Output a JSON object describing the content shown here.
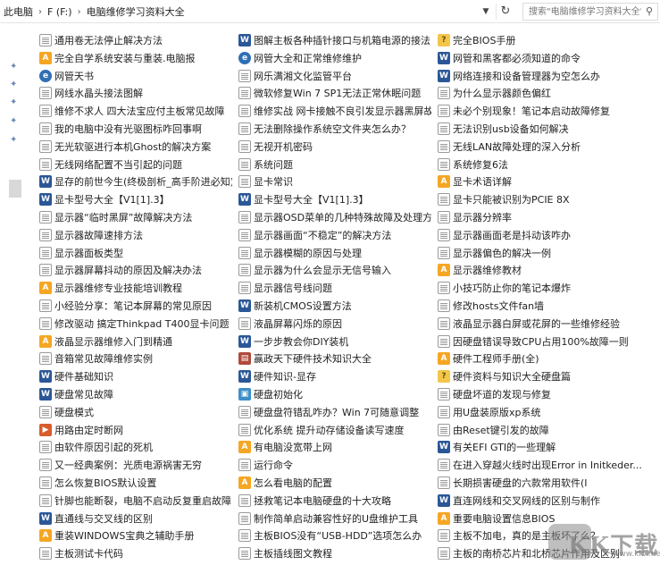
{
  "address": {
    "crumbs": [
      "此电脑",
      "F (F:)",
      "电脑维修学习资料大全"
    ],
    "search_placeholder": "搜索\"电脑维修学习资料大全\""
  },
  "files": [
    [
      {
        "icon": "doc",
        "label": "通用卷无法停止解决方法"
      },
      {
        "icon": "pdf",
        "label": "完全自学系统安装与重装.电脑报"
      },
      {
        "icon": "web",
        "label": "网管天书"
      },
      {
        "icon": "doc",
        "label": "网线水晶头接法图解"
      },
      {
        "icon": "doc",
        "label": "维修不求人 四大法宝应付主板常见故障"
      },
      {
        "icon": "doc",
        "label": "我的电脑中没有光驱图标咋回事啊"
      },
      {
        "icon": "doc",
        "label": "无光软驱进行本机Ghost的解决方案"
      },
      {
        "icon": "doc",
        "label": "无线网络配置不当引起的问题"
      },
      {
        "icon": "word",
        "label": "显存的前世今生(终极剖析_高手阶进必知)"
      },
      {
        "icon": "word",
        "label": "显卡型号大全【V1[1].3】"
      },
      {
        "icon": "doc",
        "label": "显示器“临时黑屏”故障解决方法"
      },
      {
        "icon": "doc",
        "label": "显示器故障速排方法"
      },
      {
        "icon": "doc",
        "label": "显示器面板类型"
      },
      {
        "icon": "doc",
        "label": "显示器屏幕抖动的原因及解决办法"
      },
      {
        "icon": "pdf",
        "label": "显示器维修专业技能培训教程"
      },
      {
        "icon": "doc",
        "label": "小经验分享：笔记本屏幕的常见原因"
      },
      {
        "icon": "doc",
        "label": "修改驱动 搞定Thinkpad T400显卡问题"
      },
      {
        "icon": "pdf",
        "label": "液晶显示器维修入门到精通"
      },
      {
        "icon": "doc",
        "label": "音箱常见故障维修实例"
      },
      {
        "icon": "word",
        "label": "硬件基础知识"
      },
      {
        "icon": "word",
        "label": "硬盘常见故障"
      },
      {
        "icon": "doc",
        "label": "硬盘模式"
      },
      {
        "icon": "exe",
        "label": "用路由定时断网"
      },
      {
        "icon": "doc",
        "label": "由软件原因引起的死机"
      },
      {
        "icon": "doc",
        "label": "又一经典案例：光质电源祸害无穷"
      },
      {
        "icon": "doc",
        "label": "怎么恢复BIOS默认设置"
      },
      {
        "icon": "doc",
        "label": "针脚也能断裂，电脑不启动反复重启故障"
      },
      {
        "icon": "word",
        "label": "直通线与交叉线的区别"
      },
      {
        "icon": "pdf",
        "label": "重装WINDOWS宝典之辅助手册"
      },
      {
        "icon": "doc",
        "label": "主板测试卡代码"
      }
    ],
    [
      {
        "icon": "word",
        "label": "图解主板各种插针接口与机箱电源的接法"
      },
      {
        "icon": "web",
        "label": "网管大全和正常维修维护"
      },
      {
        "icon": "doc",
        "label": "网乐满湘文化监管平台"
      },
      {
        "icon": "doc",
        "label": "微软修复Win 7 SP1无法正常休眠问题"
      },
      {
        "icon": "doc",
        "label": "维修实战 网卡接触不良引发显示器黑屏故..."
      },
      {
        "icon": "doc",
        "label": "无法删除操作系统空文件夹怎么办？"
      },
      {
        "icon": "doc",
        "label": "无视开机密码"
      },
      {
        "icon": "doc",
        "label": "系统问题"
      },
      {
        "icon": "doc",
        "label": "显卡常识"
      },
      {
        "icon": "word",
        "label": "显卡型号大全【V1[1].3】"
      },
      {
        "icon": "doc",
        "label": "显示器OSD菜单的几种特殊故障及处理方法"
      },
      {
        "icon": "doc",
        "label": "显示器画面“不稳定”的解决方法"
      },
      {
        "icon": "doc",
        "label": "显示器模糊的原因与处理"
      },
      {
        "icon": "doc",
        "label": "显示器为什么会显示无信号输入"
      },
      {
        "icon": "doc",
        "label": "显示器信号线问题"
      },
      {
        "icon": "word",
        "label": "新装机CMOS设置方法"
      },
      {
        "icon": "doc",
        "label": "液晶屏幕闪烁的原因"
      },
      {
        "icon": "word",
        "label": "一步步教会你DIY装机"
      },
      {
        "icon": "book",
        "label": "赢政天下硬件技术知识大全"
      },
      {
        "icon": "word",
        "label": "硬件知识-显存"
      },
      {
        "icon": "img",
        "label": "硬盘初始化"
      },
      {
        "icon": "doc",
        "label": "硬盘盘符错乱咋办？Win 7可随意调整"
      },
      {
        "icon": "doc",
        "label": "优化系统 提升动存储设备读写速度"
      },
      {
        "icon": "pdf",
        "label": "有电脑没宽带上网"
      },
      {
        "icon": "doc",
        "label": "运行命令"
      },
      {
        "icon": "pdf",
        "label": "怎么看电脑的配置"
      },
      {
        "icon": "doc",
        "label": "拯救笔记本电脑硬盘的十大攻略"
      },
      {
        "icon": "doc",
        "label": "制作简单启动兼容性好的U盘维护工具"
      },
      {
        "icon": "doc",
        "label": "主板BIOS没有“USB-HDD”选项怎么办"
      },
      {
        "icon": "doc",
        "label": "主板插线图文教程"
      }
    ],
    [
      {
        "icon": "chm",
        "label": "完全BIOS手册"
      },
      {
        "icon": "word",
        "label": "网管和黑客都必须知道的命令"
      },
      {
        "icon": "word",
        "label": "网络连接和设备管理器为空怎么办"
      },
      {
        "icon": "doc",
        "label": "为什么显示器颜色偏红"
      },
      {
        "icon": "doc",
        "label": "未必个别现象！笔记本启动故障修复"
      },
      {
        "icon": "doc",
        "label": "无法识别usb设备如何解决"
      },
      {
        "icon": "doc",
        "label": "无线LAN故障处理的深入分析"
      },
      {
        "icon": "doc",
        "label": "系统修复6法"
      },
      {
        "icon": "pdf",
        "label": "显卡术语详解"
      },
      {
        "icon": "doc",
        "label": "显卡只能被识别为PCIE 8X"
      },
      {
        "icon": "doc",
        "label": "显示器分辨率"
      },
      {
        "icon": "doc",
        "label": "显示器画面老是抖动该咋办"
      },
      {
        "icon": "doc",
        "label": "显示器偏色的解决一例"
      },
      {
        "icon": "pdf",
        "label": "显示器维修教材"
      },
      {
        "icon": "doc",
        "label": "小技巧防止你的笔记本爆炸"
      },
      {
        "icon": "doc",
        "label": "修改hosts文件fan墙"
      },
      {
        "icon": "doc",
        "label": "液晶显示器白屏或花屏的一些维修经验"
      },
      {
        "icon": "doc",
        "label": "因硬盘错误导致CPU占用100%故障一则"
      },
      {
        "icon": "pdf",
        "label": "硬件工程师手册(全)"
      },
      {
        "icon": "chm",
        "label": "硬件资料与知识大全硬盘篇"
      },
      {
        "icon": "doc",
        "label": "硬盘坏道的发现与修复"
      },
      {
        "icon": "doc",
        "label": "用U盘装原版xp系统"
      },
      {
        "icon": "doc",
        "label": "由Reset键引发的故障"
      },
      {
        "icon": "word",
        "label": "有关EFI GTI的一些理解"
      },
      {
        "icon": "doc",
        "label": "在进入穿越火线时出现Error in Initkeder..."
      },
      {
        "icon": "doc",
        "label": "长期损害硬盘的六款常用软件(I"
      },
      {
        "icon": "word",
        "label": "直连网线和交叉网线的区别与制作"
      },
      {
        "icon": "pdf",
        "label": "重要电脑设置信息BIOS"
      },
      {
        "icon": "doc",
        "label": "主板不加电，真的是主板坏了么？"
      },
      {
        "icon": "doc",
        "label": "主板的南桥芯片和北桥芯片作用及区别"
      }
    ]
  ],
  "watermark": {
    "brand": "KK下载",
    "site": "www.kkx.net"
  }
}
